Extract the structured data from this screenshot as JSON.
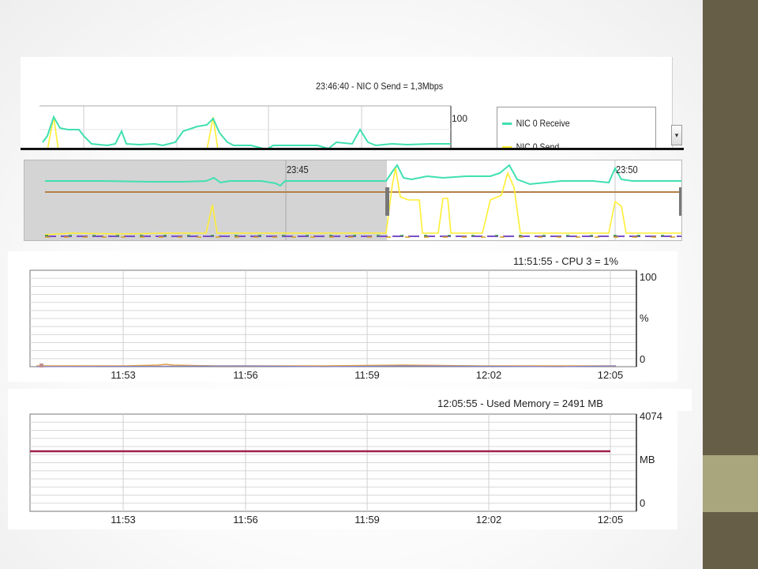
{
  "nic_chart": {
    "title": "23:46:40 - NIC 0 Send = 1,3Mbps",
    "y_max_label": "100",
    "legend": [
      {
        "label": "NIC 0 Receive",
        "color": "#40e0b0"
      },
      {
        "label": "NIC 0 Send",
        "color": "#ffee33"
      }
    ],
    "scroll_glyph": "▾"
  },
  "overview": {
    "tick_labels": [
      "23:45",
      "23:50"
    ]
  },
  "cpu_chart": {
    "title": "11:51:55 - CPU 3 = 1%",
    "y_axis": {
      "max": "100",
      "unit": "%",
      "min": "0"
    },
    "x_ticks": [
      "11:53",
      "11:56",
      "11:59",
      "12:02",
      "12:05"
    ]
  },
  "memory_chart": {
    "title": "12:05:55 - Used Memory = 2491 MB",
    "y_axis": {
      "max": "4074",
      "unit": "MB",
      "min": "0"
    },
    "x_ticks": [
      "11:53",
      "11:56",
      "11:59",
      "12:02",
      "12:05"
    ],
    "series_color": "#a0204a"
  },
  "colors": {
    "side_bar": "#675e47",
    "side_accent": "#a9a57c",
    "receive": "#40e0b0",
    "send": "#ffee33",
    "brown_line": "#b5804a",
    "selection_gray": "#d4d4d4"
  }
}
